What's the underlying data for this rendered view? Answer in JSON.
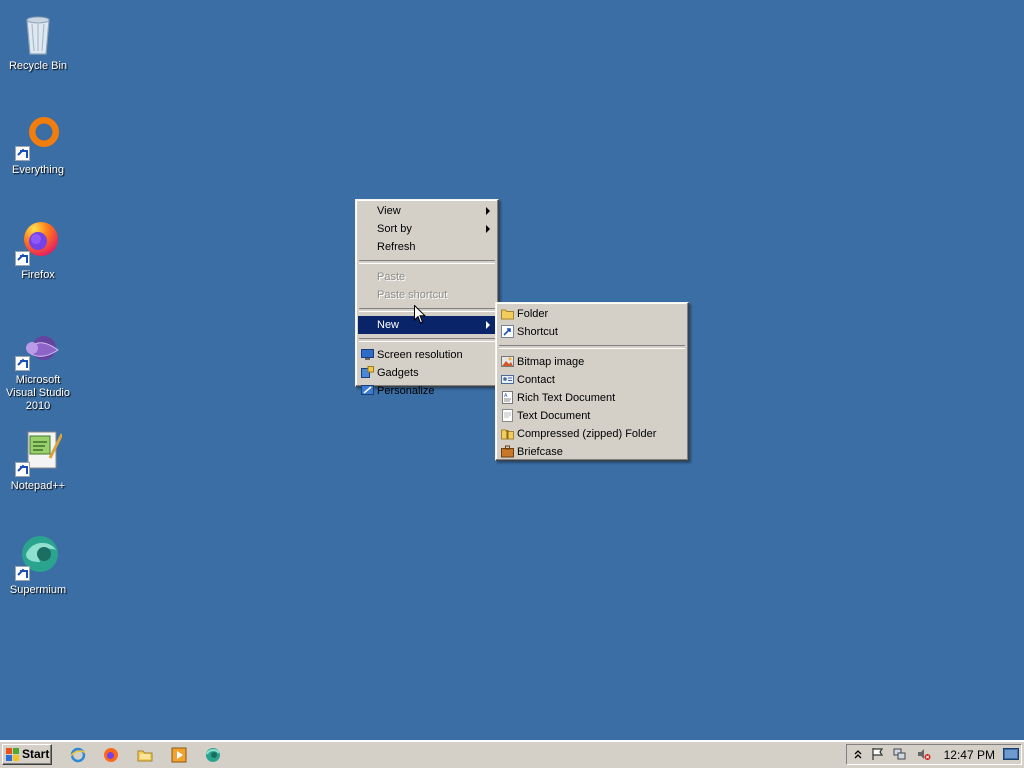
{
  "desktop": {
    "icons": [
      {
        "label": "Recycle Bin",
        "icon": "recycle-bin-icon"
      },
      {
        "label": "Everything",
        "icon": "everything-icon"
      },
      {
        "label": "Firefox",
        "icon": "firefox-icon"
      },
      {
        "label": "Microsoft Visual Studio 2010",
        "icon": "visual-studio-icon"
      },
      {
        "label": "Notepad++",
        "icon": "notepadpp-icon"
      },
      {
        "label": "Supermium",
        "icon": "supermium-icon"
      }
    ],
    "background_color": "#3a6ea5"
  },
  "context_menu": {
    "items": {
      "view": "View",
      "sort_by": "Sort by",
      "refresh": "Refresh",
      "paste": "Paste",
      "paste_shortcut": "Paste shortcut",
      "new": "New",
      "screen_resolution": "Screen resolution",
      "gadgets": "Gadgets",
      "personalize": "Personalize"
    }
  },
  "new_submenu": {
    "items": {
      "folder": "Folder",
      "shortcut": "Shortcut",
      "bitmap": "Bitmap image",
      "contact": "Contact",
      "rtf": "Rich Text Document",
      "text": "Text Document",
      "zip": "Compressed (zipped) Folder",
      "briefcase": "Briefcase"
    }
  },
  "taskbar": {
    "start_label": "Start",
    "quick_launch": [
      "ie-icon",
      "firefox-icon",
      "explorer-icon",
      "media-player-icon",
      "supermium-icon"
    ],
    "clock": "12:47 PM",
    "tray_icons": [
      "show-hidden-icons-icon",
      "action-center-flag-icon",
      "network-icon",
      "volume-muted-icon",
      "show-desktop-icon"
    ]
  },
  "colors": {
    "menu_bg": "#d4d0c8",
    "selection": "#0a246a"
  }
}
